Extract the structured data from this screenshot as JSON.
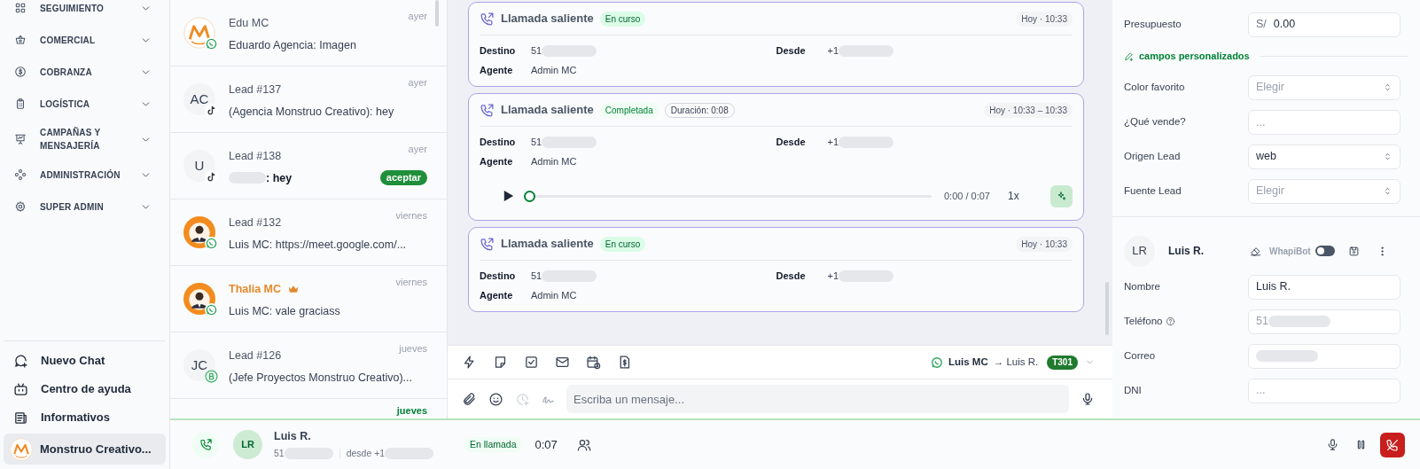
{
  "sidebar": {
    "menu": [
      {
        "label": "SEGUIMIENTO"
      },
      {
        "label": "COMERCIAL"
      },
      {
        "label": "COBRANZA"
      },
      {
        "label": "LOGÍSTICA"
      },
      {
        "label": "CAMPAÑAS Y MENSAJERÍA"
      },
      {
        "label": "ADMINISTRACIÓN"
      },
      {
        "label": "SUPER ADMIN"
      }
    ],
    "footer": [
      {
        "label": "Nuevo Chat"
      },
      {
        "label": "Centro de ayuda"
      },
      {
        "label": "Informativos"
      }
    ],
    "account": {
      "name": "Monstruo Creativo...",
      "selected": true
    }
  },
  "chats": [
    {
      "avatar": {
        "kind": "logo"
      },
      "badge": {
        "kind": "whatsapp"
      },
      "name": "Edu MC",
      "preview": "Eduardo Agencia: Imagen",
      "time": "ayer"
    },
    {
      "avatar": {
        "kind": "initials",
        "text": "AC"
      },
      "badge": {
        "kind": "tiktok"
      },
      "name": "Lead #137",
      "preview": "(Agencia Monstruo Creativo): hey",
      "time": "ayer"
    },
    {
      "avatar": {
        "kind": "initials",
        "text": "U"
      },
      "badge": {
        "kind": "tiktok"
      },
      "name": "Lead #138",
      "preview": ": hey",
      "preview_redacted": true,
      "unread": true,
      "action": "aceptar",
      "time": "ayer"
    },
    {
      "badge": {
        "kind": "whatsapp"
      },
      "name": "Lead #132",
      "preview": "Luis MC: https://meet.google.com/...",
      "time": "viernes"
    },
    {
      "badge": {
        "kind": "whatsapp"
      },
      "name": "Thalia MC",
      "vip": true,
      "preview": "Luis MC: vale graciass",
      "time": "viernes"
    },
    {
      "avatar": {
        "kind": "initials",
        "text": "JC"
      },
      "badge": {
        "kind": "business"
      },
      "name": "Lead #126",
      "preview": "(Jefe Proyectos Monstruo Creativo)...",
      "time": "jueves"
    },
    {
      "unread": true,
      "time": "jueves"
    }
  ],
  "calls": [
    {
      "title": "Llamada saliente",
      "status": {
        "text": "En curso",
        "kind": "active"
      },
      "time": "Hoy · 10:33",
      "fields": [
        {
          "label": "Destino",
          "value": "51",
          "redacted": true
        },
        {
          "label": "Desde",
          "value": "+1",
          "redacted": true
        },
        {
          "label": "Agente",
          "value": "Admin MC"
        }
      ]
    },
    {
      "title": "Llamada saliente",
      "status": {
        "text": "Completada",
        "kind": "completed"
      },
      "duration": "Duración: 0:08",
      "time": "Hoy · 10:33 – 10:33",
      "fields": [
        {
          "label": "Destino",
          "value": "51",
          "redacted": true
        },
        {
          "label": "Desde",
          "value": "+1",
          "redacted": true
        },
        {
          "label": "Agente",
          "value": "Admin MC"
        }
      ],
      "recording": {
        "level": 0,
        "time": "0:00 / 0:07",
        "speed": "1x"
      }
    },
    {
      "title": "Llamada saliente",
      "status": {
        "text": "En curso",
        "kind": "active"
      },
      "time": "Hoy · 10:33",
      "fields": [
        {
          "label": "Destino",
          "value": "51",
          "redacted": true
        },
        {
          "label": "Desde",
          "value": "+1",
          "redacted": true
        },
        {
          "label": "Agente",
          "value": "Admin MC"
        }
      ]
    }
  ],
  "composer": {
    "sender": "Luis MC",
    "recipient": "→ Luis R.",
    "line": "T301",
    "placeholder": "Escriba un mensaje..."
  },
  "details": {
    "budget": {
      "label": "Presupuesto",
      "currency": "S/",
      "value": "0.00"
    },
    "custom_title": "campos personalizados",
    "custom_fields": [
      {
        "label": "Color favorito",
        "kind": "select",
        "placeholder": "Elegir"
      },
      {
        "label": "¿Qué vende?",
        "kind": "text",
        "placeholder": "..."
      },
      {
        "label": "Origen Lead",
        "kind": "select",
        "value": "web"
      },
      {
        "label": "Fuente Lead",
        "kind": "select",
        "placeholder": "Elegir"
      }
    ]
  },
  "contact": {
    "initials": "LR",
    "name": "Luis R.",
    "bot_label": "WhapiBot",
    "bot_on": false,
    "fields": [
      {
        "label": "Nombre",
        "value": "Luis R."
      },
      {
        "label": "Teléfono",
        "help": true,
        "disabled": true,
        "value": "51",
        "redacted": true
      },
      {
        "label": "Correo",
        "redacted": true
      },
      {
        "label": "DNI",
        "placeholder": "..."
      }
    ]
  },
  "call_bar": {
    "initials": "LR",
    "name": "Luis R.",
    "number": "51",
    "number_redacted": true,
    "from": "desde +1",
    "from_redacted": true,
    "status": "En llamada",
    "timer": "0:07"
  }
}
